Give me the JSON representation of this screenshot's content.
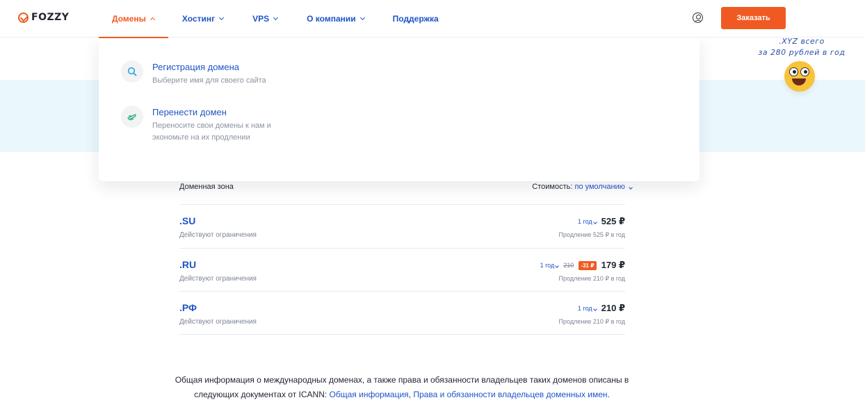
{
  "logo": {
    "text": "FOZZY"
  },
  "nav": [
    {
      "label": "Домены",
      "active": true
    },
    {
      "label": "Хостинг"
    },
    {
      "label": "VPS"
    },
    {
      "label": "О компании"
    },
    {
      "label": "Поддержка"
    }
  ],
  "header": {
    "order_label": "Заказать"
  },
  "promo": {
    "line1": ".XYZ всего",
    "line2": "за 280 рублей в год"
  },
  "dropdown": {
    "items": [
      {
        "title": "Регистрация домена",
        "desc": "Выберите имя для своего сайта",
        "icon": "search-icon"
      },
      {
        "title": "Перенести домен",
        "desc": "Переносите свои домены к нам и экономьте на их продлении",
        "icon": "transfer-icon"
      }
    ]
  },
  "table": {
    "zone_header": "Доменная зона",
    "sort_label": "Стоимость:",
    "sort_value": "по умолчанию",
    "rows": [
      {
        "zone": ".SU",
        "restriction": "Действуют ограничения",
        "period": "1 год",
        "price": "525 ₽",
        "renew": "Продление 525 ₽ в год"
      },
      {
        "zone": ".RU",
        "restriction": "Действуют ограничения",
        "period": "1 год",
        "old_price": "210",
        "discount": "-31 ₽",
        "price": "179 ₽",
        "renew": "Продление 210 ₽ в год"
      },
      {
        "zone": ".РФ",
        "restriction": "Действуют ограничения",
        "period": "1 год",
        "price": "210 ₽",
        "renew": "Продление 210 ₽ в год"
      }
    ]
  },
  "info": {
    "text_before": "Общая информация о международных доменах, а также права и обязанности владельцев таких доменов описаны в следующих документах от ICANN: ",
    "link1": "Общая информация",
    "separator": ", ",
    "link2": "Права и обязанности владельцев доменных имен",
    "text_after": "."
  },
  "colors": {
    "accent": "#f05a22",
    "link": "#1e54c8",
    "band": "#eaf8fd"
  }
}
